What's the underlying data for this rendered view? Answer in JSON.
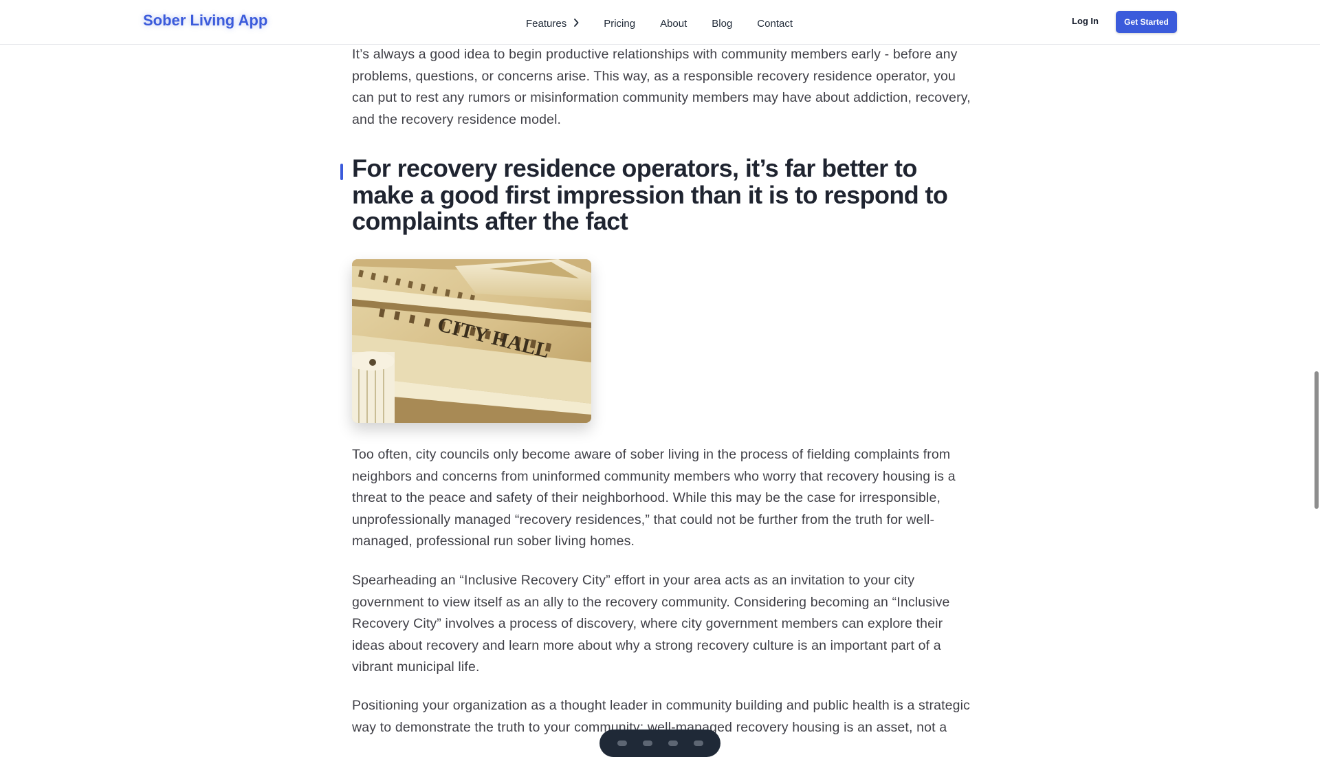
{
  "header": {
    "logo": "Sober Living App",
    "nav": [
      {
        "label": "Features",
        "icon": "chevron-right-icon"
      },
      {
        "label": "Pricing"
      },
      {
        "label": "About"
      },
      {
        "label": "Blog"
      },
      {
        "label": "Contact"
      }
    ],
    "login_label": "Log In",
    "cta_label": "Get Started"
  },
  "article": {
    "paragraph_1": "It’s always a good idea to begin productive relationships with community members early - before any problems, questions, or concerns arise. This way, as a responsible recovery residence operator, you can put to rest any rumors or misinformation community members may have about addiction, recovery, and the recovery residence model.",
    "heading": "For recovery residence operators, it’s far better to make a good first impression than it is to respond to complaints after the fact",
    "image": {
      "sign_text": "CITY HALL"
    },
    "paragraph_2": "Too often, city councils only become aware of sober living in the process of fielding complaints from neighbors and concerns from uninformed community members who worry that recovery housing is a threat to the peace and safety of their neighborhood. While this may be the case for irresponsible, unprofessionally managed “recovery residences,” that could not be further from the truth for well-managed, professional run sober living homes.",
    "paragraph_3": "Spearheading an “Inclusive Recovery City” effort in your area acts as an invitation to your city government to view itself as an ally to the recovery community. Considering becoming an “Inclusive Recovery City” involves a process of discovery, where city government members can explore their ideas about recovery and learn more about why a strong recovery culture is an important part of a vibrant municipal life.",
    "paragraph_4": "Positioning your organization as a thought leader in community building and public health is a strategic way to demonstrate the truth to your community: well-managed recovery housing is an asset, not a"
  },
  "colors": {
    "accent": "#3b5bdb",
    "heading": "#1f2430",
    "body_text": "#3f3f46"
  }
}
